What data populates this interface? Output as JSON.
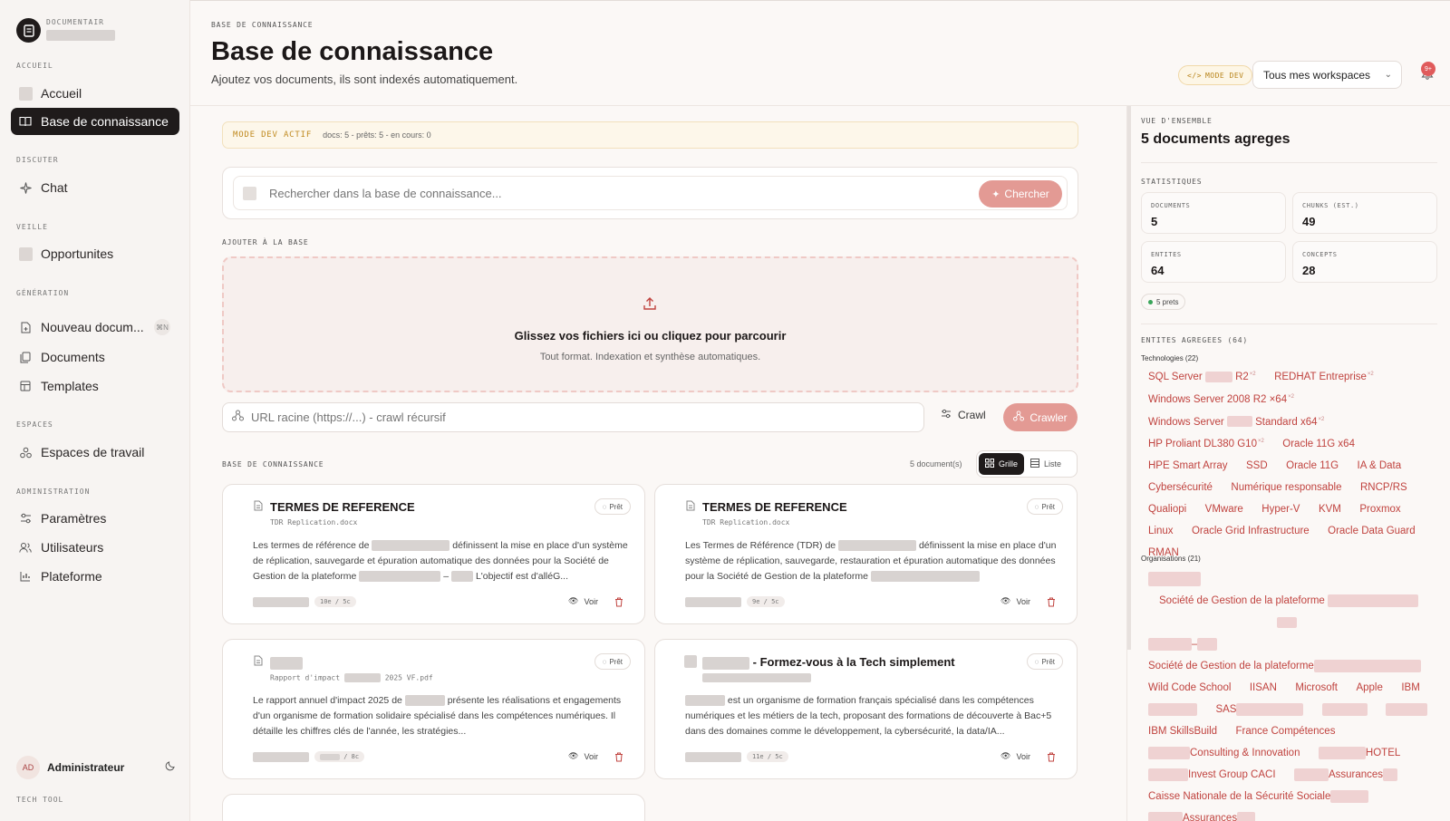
{
  "brand": {
    "name": "DOCUMENTAIR"
  },
  "sidebar": {
    "sections": [
      {
        "label": "ACCUEIL"
      },
      {
        "label": "DISCUTER"
      },
      {
        "label": "VEILLE"
      },
      {
        "label": "GÉNÉRATION"
      },
      {
        "label": "ESPACES"
      },
      {
        "label": "ADMINISTRATION"
      }
    ],
    "items": [
      {
        "label": "Accueil"
      },
      {
        "label": "Base de connaissance"
      },
      {
        "label": "Chat"
      },
      {
        "label": "Opportunites"
      },
      {
        "label": "Nouveau docum...",
        "shortcut": "⌘N"
      },
      {
        "label": "Documents"
      },
      {
        "label": "Templates"
      },
      {
        "label": "Espaces de travail"
      },
      {
        "label": "Paramètres"
      },
      {
        "label": "Utilisateurs"
      },
      {
        "label": "Plateforme"
      }
    ],
    "user": {
      "initials": "AD",
      "name": "Administrateur"
    },
    "footer": "TECH TOOL"
  },
  "header": {
    "breadcrumb": "BASE DE CONNAISSANCE",
    "title": "Base de connaissance",
    "subtitle": "Ajoutez vos documents, ils sont indexés automatiquement.",
    "dev_mode": "MODE DEV",
    "workspace": "Tous mes workspaces",
    "notif_count": "9+"
  },
  "main": {
    "dev_banner": {
      "label": "MODE DEV ACTIF",
      "info": "docs: 5 - prêts: 5 - en cours: 0"
    },
    "search": {
      "placeholder": "Rechercher dans la base de connaissance...",
      "button": "Chercher"
    },
    "add_label": "AJOUTER À LA BASE",
    "dropzone": {
      "title": "Glissez vos fichiers ici ou cliquez pour parcourir",
      "subtitle": "Tout format. Indexation et synthèse automatiques."
    },
    "crawl": {
      "placeholder": "URL racine (https://...) - crawl récursif",
      "link": "Crawl",
      "button": "Crawler"
    },
    "kb_label": "BASE DE CONNAISSANCE",
    "doc_count": "5 document(s)",
    "view": {
      "grid": "Grille",
      "list": "Liste"
    },
    "cards": [
      {
        "title": "TERMES DE REFERENCE",
        "file": "TDR Replication.docx",
        "status": "Prêt",
        "desc": [
          "Les termes de référence de",
          "définissent la mise en place d'un",
          "système de réplication, sauvegarde et épuration automatique des données pour la",
          "Société de Gestion de la plateforme",
          "–",
          "L'objectif est d'alléG..."
        ],
        "chip": "10e / 5c",
        "view": "Voir"
      },
      {
        "title": "TERMES DE REFERENCE",
        "file": "TDR Replication.docx",
        "status": "Prêt",
        "desc": [
          "Les Termes de Référence (TDR) de",
          "définissent la mise en place",
          "d'un système de réplication, sauvegarde, restauration et épuration automatique",
          "des données pour la Société de Gestion de la plateforme"
        ],
        "chip": "9e / 5c",
        "view": "Voir"
      },
      {
        "title": "",
        "file_a": "Rapport d'impact",
        "file_b": "2025 VF.pdf",
        "status": "Prêt",
        "desc": [
          "Le rapport annuel d'impact 2025 de",
          "présente les réalisations et",
          "engagements d'un organisme de formation solidaire spécialisé dans les",
          "compétences numériques. Il détaille les chiffres clés de l'année, les stratégies..."
        ],
        "chip": "/ 8c",
        "view": "Voir"
      },
      {
        "title": "- Formez-vous à la Tech simplement",
        "status": "Prêt",
        "desc": [
          "est un organisme de formation français spécialisé dans les compétences",
          "numériques et les métiers de la tech, proposant des formations de découverte à",
          "Bac+5 dans des domaines comme le développement, la cybersécurité, la data/IA..."
        ],
        "chip": "11e / 5c",
        "view": "Voir"
      }
    ]
  },
  "panel": {
    "overview_label": "VUE D'ENSEMBLE",
    "overview_title": "5 documents agreges",
    "stats_label": "STATISTIQUES",
    "stats": [
      {
        "label": "DOCUMENTS",
        "value": "5"
      },
      {
        "label": "CHUNKS (EST.)",
        "value": "49"
      },
      {
        "label": "ENTITES",
        "value": "64"
      },
      {
        "label": "CONCEPTS",
        "value": "28"
      }
    ],
    "ready": "5 prets",
    "entities_label": "ENTITES AGREGEES (64)",
    "tech_label": "Technologies (22)",
    "technologies": [
      {
        "a": "SQL Server",
        "b": "R2",
        "sup": "×2"
      },
      {
        "a": "REDHAT Entreprise",
        "sup": "×2"
      },
      {
        "a": "Windows Server 2008 R2 ×64",
        "sup": "×2"
      },
      {
        "a": "Windows Server",
        "b": "Standard x64",
        "sup": "×2"
      },
      {
        "a": "HP Proliant DL380 G10",
        "sup": "×2"
      },
      {
        "a": "Oracle 11G x64"
      },
      {
        "a": "HPE Smart Array"
      },
      {
        "a": "SSD"
      },
      {
        "a": "Oracle 11G"
      },
      {
        "a": "IA & Data"
      },
      {
        "a": "Cybersécurité"
      },
      {
        "a": "Numérique responsable"
      },
      {
        "a": "RNCP/RS"
      },
      {
        "a": "Qualiopi"
      },
      {
        "a": "VMware"
      },
      {
        "a": "Hyper-V"
      },
      {
        "a": "KVM"
      },
      {
        "a": "Proxmox"
      },
      {
        "a": "Linux"
      },
      {
        "a": "Oracle Grid Infrastructure"
      },
      {
        "a": "Oracle Data Guard"
      },
      {
        "a": "RMAN"
      }
    ],
    "org_label": "Organisations (21)",
    "organisations": {
      "soc1": "Société de Gestion de la plateforme",
      "dash": "–",
      "soc2": "Société de Gestion de la plateforme",
      "row1": [
        "Wild Code School",
        "IISAN",
        "Microsoft",
        "Apple",
        "IBM"
      ],
      "sas": "SAS",
      "row2": [
        "IBM SkillsBuild",
        "France Compétences"
      ],
      "ci": "Consulting & Innovation",
      "hotel": "HOTEL",
      "invest": "Invest Group CACI",
      "assur1": "Assurances",
      "cnss": "Caisse Nationale de la Sécurité Sociale",
      "assur2": "Assurances"
    }
  }
}
